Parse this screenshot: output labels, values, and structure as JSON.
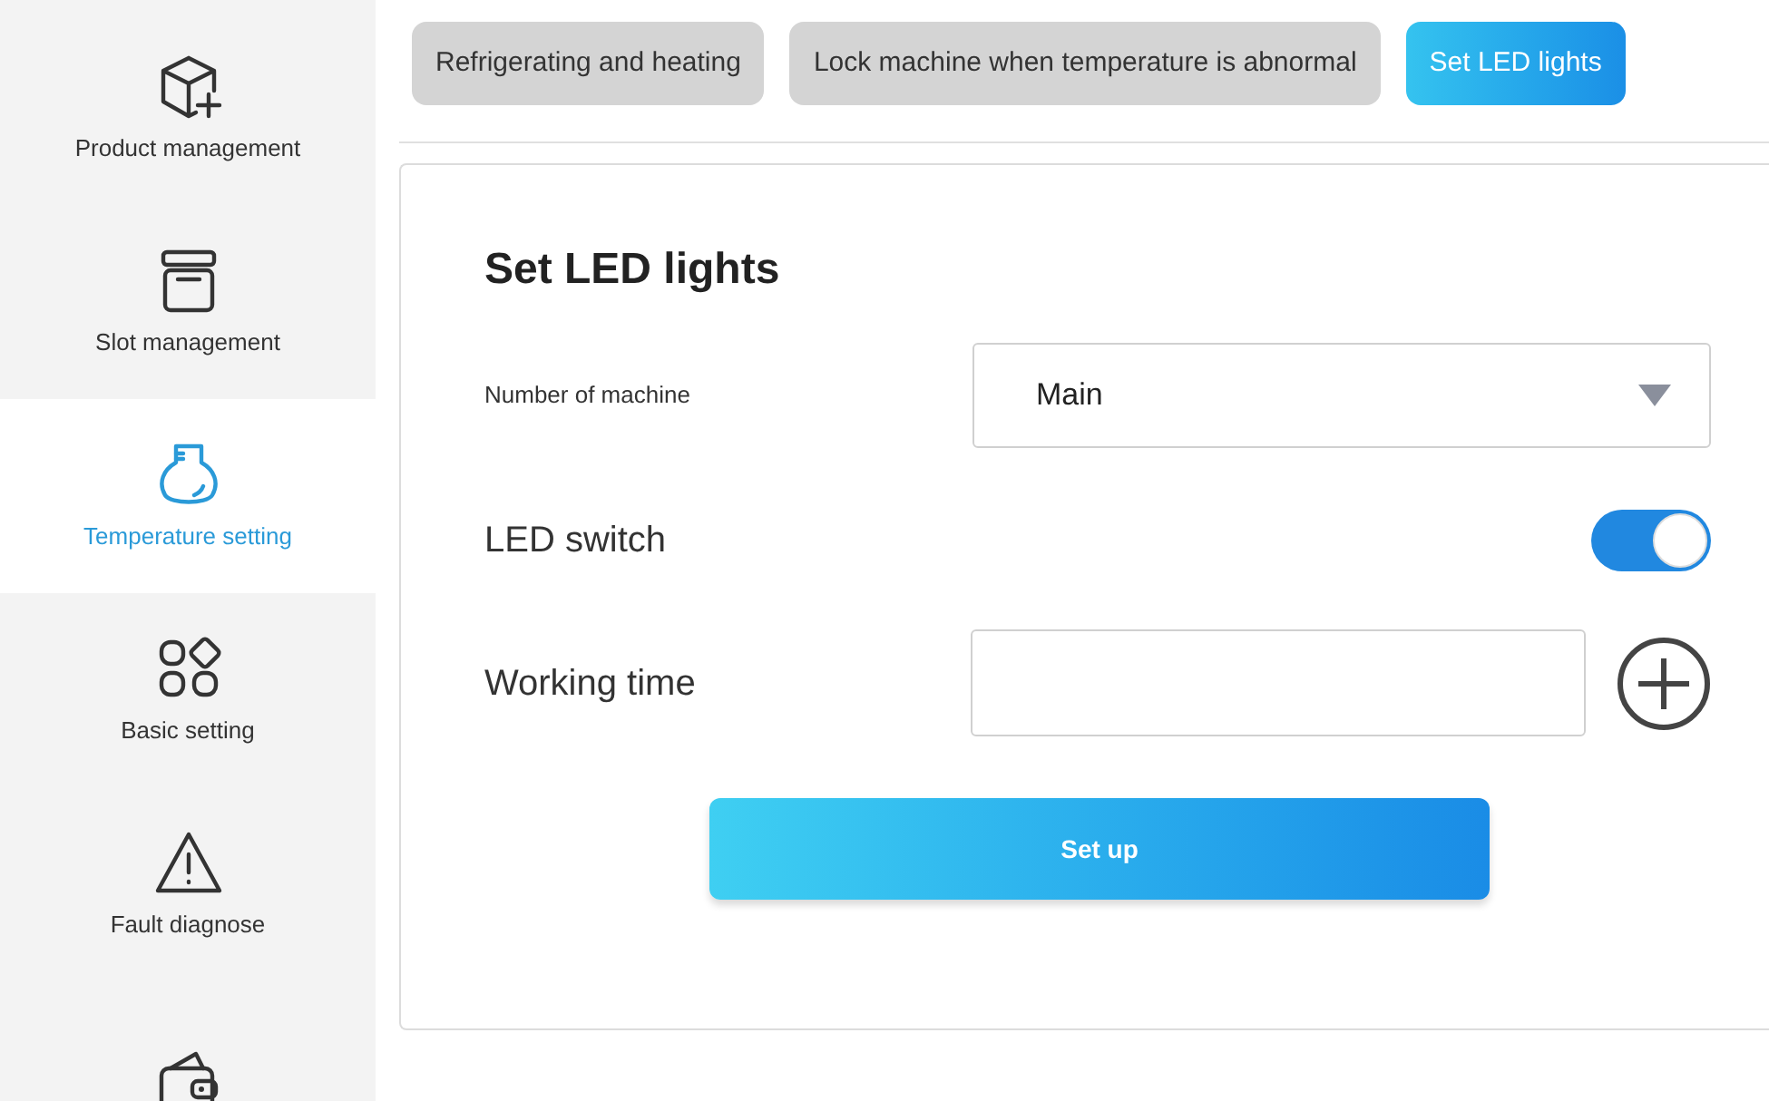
{
  "sidebar": {
    "items": [
      {
        "label": "Product management",
        "selected": false
      },
      {
        "label": "Slot management",
        "selected": false
      },
      {
        "label": "Temperature setting",
        "selected": true
      },
      {
        "label": "Basic setting",
        "selected": false
      },
      {
        "label": "Fault diagnose",
        "selected": false
      },
      {
        "selected": false
      }
    ]
  },
  "tabs": [
    {
      "label": "Refrigerating and heating",
      "selected": false
    },
    {
      "label": "Lock machine when temperature is abnormal",
      "selected": false
    },
    {
      "label": "Set LED lights",
      "selected": true
    }
  ],
  "panel": {
    "title": "Set LED lights",
    "machine": {
      "label": "Number of machine",
      "value": "Main"
    },
    "led_switch": {
      "label": "LED switch",
      "on": true
    },
    "working_time": {
      "label": "Working time"
    },
    "button": "Set up"
  }
}
